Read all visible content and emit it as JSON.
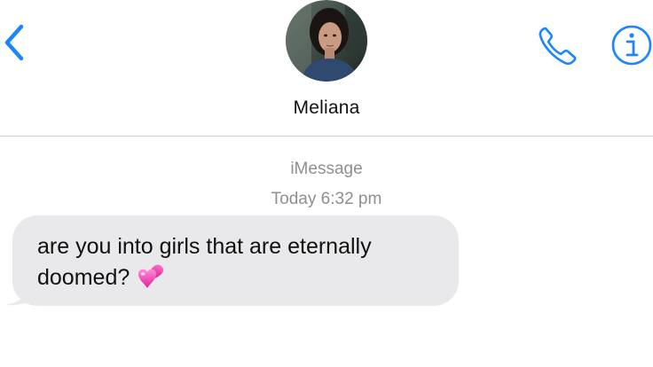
{
  "header": {
    "contact_name": "Meliana",
    "back_icon": "chevron-left-icon",
    "call_icon": "phone-icon",
    "info_icon": "info-icon",
    "accent_color": "#1b84ff"
  },
  "conversation": {
    "service_label": "iMessage",
    "timestamp_day": "Today",
    "timestamp_time": "6:32 pm",
    "messages": [
      {
        "direction": "incoming",
        "text": "are you into girls that are eternally doomed?",
        "emoji": "two-hearts-icon",
        "bubble_color": "#e9e9eb"
      }
    ]
  }
}
